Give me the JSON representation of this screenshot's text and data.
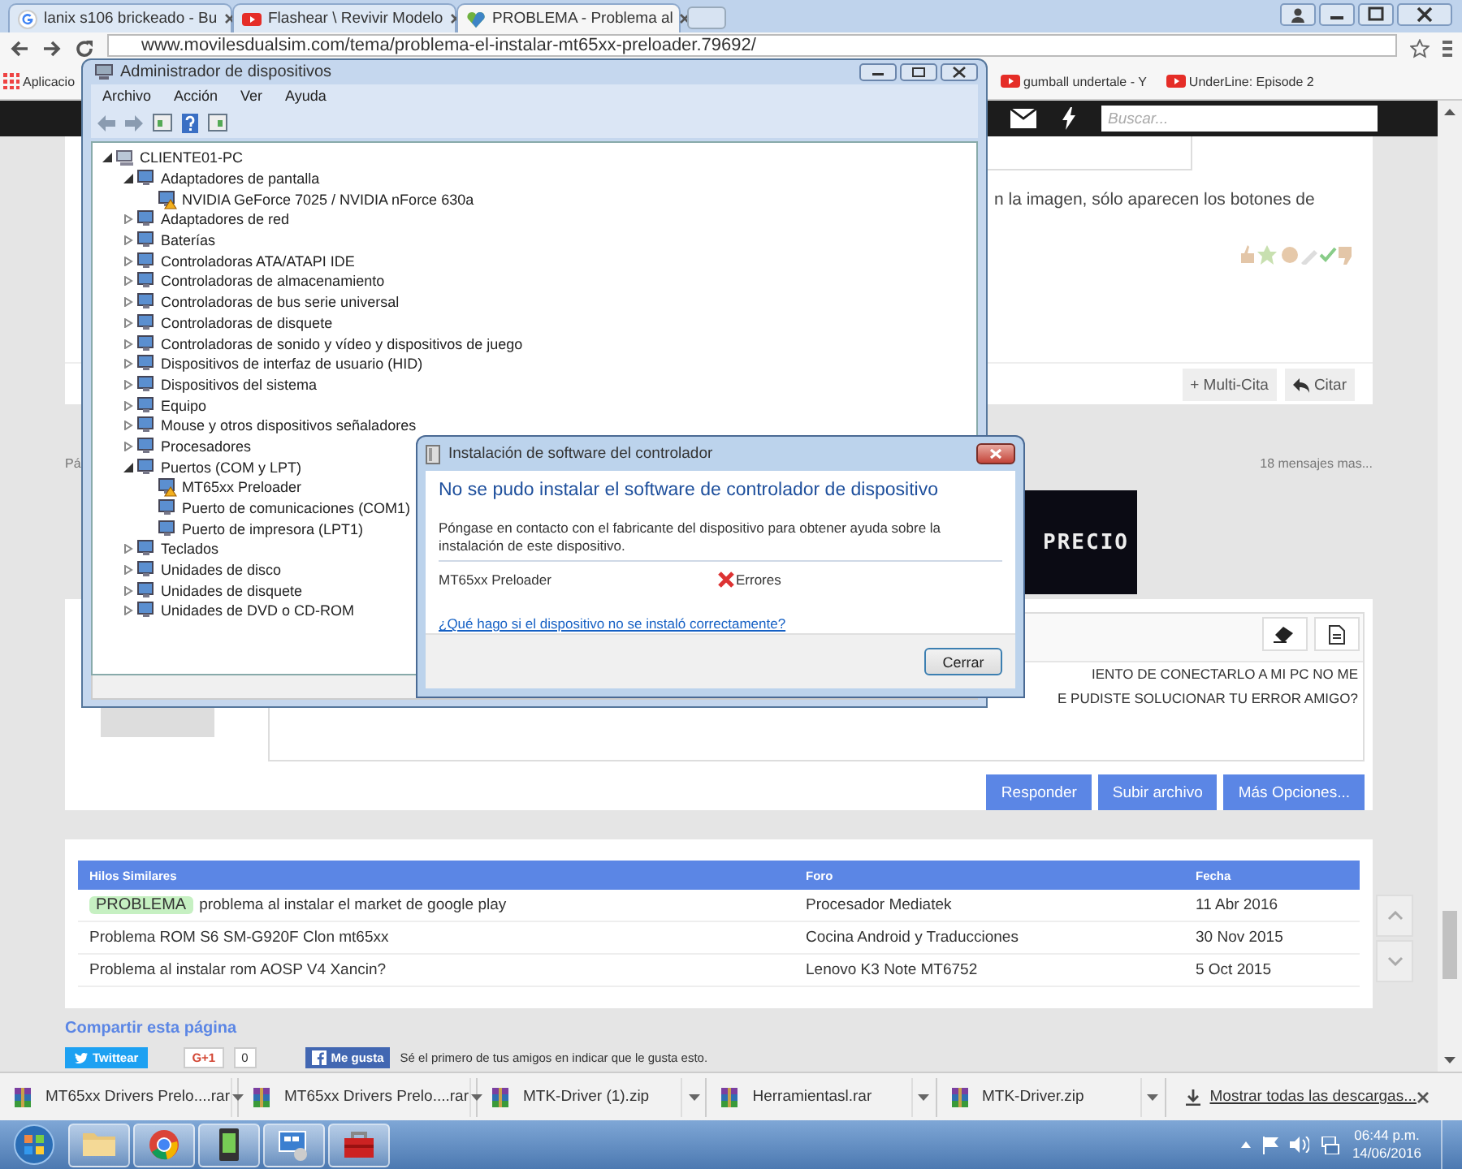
{
  "browser": {
    "tabs": [
      {
        "title": "lanix s106 brickeado - Bu",
        "selected": false
      },
      {
        "title": "Flashear \\ Revivir Modelo",
        "selected": false
      },
      {
        "title": "PROBLEMA - Problema al",
        "selected": true
      }
    ],
    "address": "www.movilesdualsim.com/tema/problema-el-instalar-mt65xx-preloader.79692/",
    "bookmarks": [
      {
        "label": "Aplicacio",
        "kind": "apps"
      },
      {
        "label": "gumball undertale - Y",
        "kind": "video"
      },
      {
        "label": "UnderLine: Episode 2",
        "kind": "video"
      }
    ]
  },
  "forum": {
    "search": {
      "placeholder": "Buscar..."
    },
    "post_text": "n la imagen, sólo aparecen los botones de",
    "post_buttons": [
      "+ Multi-Cita",
      "Citar"
    ],
    "page_label": "Pá",
    "more_messages": "18 mensajes mas...",
    "banner_text": "PRECIO",
    "editor_lines": [
      "IENTO DE CONECTARLO A MI PC NO ME",
      "E PUDISTE SOLUCIONAR TU ERROR AMIGO?"
    ],
    "editor_buttons": [
      "Responder",
      "Subir archivo",
      "Más Opciones..."
    ],
    "similar_threads": {
      "columns": [
        "Hilos Similares",
        "Foro",
        "Fecha"
      ],
      "rows": [
        {
          "tag": "PROBLEMA",
          "title": "problema al instalar el market de google play",
          "forum": "Procesador Mediatek",
          "date": "11 Abr 2016"
        },
        {
          "title": "Problema ROM S6 SM-G920F Clon mt65xx",
          "forum": "Cocina Android y Traducciones",
          "date": "30 Nov 2015"
        },
        {
          "title": "Problema al instalar rom AOSP V4 Xancin?",
          "forum": "Lenovo K3 Note MT6752",
          "date": "5 Oct 2015"
        }
      ]
    },
    "share": {
      "title": "Compartir esta página",
      "twitter": "Twittear",
      "gplus": "G+1",
      "gplus_count": "0",
      "like": "Me gusta",
      "like_text": "Sé el primero de tus amigos en indicar que le gusta esto."
    }
  },
  "device_manager": {
    "title": "Administrador de dispositivos",
    "menu": [
      "Archivo",
      "Acción",
      "Ver",
      "Ayuda"
    ],
    "tree": {
      "label": "CLIENTE01-PC",
      "expanded": true,
      "children": [
        {
          "label": "Adaptadores de pantalla",
          "expanded": true,
          "children": [
            {
              "label": "NVIDIA GeForce 7025 / NVIDIA nForce 630a",
              "problem": true
            }
          ]
        },
        {
          "label": "Adaptadores de red",
          "expanded": false
        },
        {
          "label": "Baterías",
          "expanded": false
        },
        {
          "label": "Controladoras ATA/ATAPI IDE",
          "expanded": false
        },
        {
          "label": "Controladoras de almacenamiento",
          "expanded": false
        },
        {
          "label": "Controladoras de bus serie universal",
          "expanded": false
        },
        {
          "label": "Controladoras de disquete",
          "expanded": false
        },
        {
          "label": "Controladoras de sonido y vídeo y dispositivos de juego",
          "expanded": false
        },
        {
          "label": "Dispositivos de interfaz de usuario (HID)",
          "expanded": false
        },
        {
          "label": "Dispositivos del sistema",
          "expanded": false
        },
        {
          "label": "Equipo",
          "expanded": false
        },
        {
          "label": "Mouse y otros dispositivos señaladores",
          "expanded": false
        },
        {
          "label": "Procesadores",
          "expanded": false
        },
        {
          "label": "Puertos (COM y LPT)",
          "expanded": true,
          "children": [
            {
              "label": "MT65xx Preloader",
              "problem": true
            },
            {
              "label": "Puerto de comunicaciones (COM1)",
              "problem": false
            },
            {
              "label": "Puerto de impresora (LPT1)",
              "problem": false
            }
          ]
        },
        {
          "label": "Teclados",
          "expanded": false
        },
        {
          "label": "Unidades de disco",
          "expanded": false
        },
        {
          "label": "Unidades de disquete",
          "expanded": false
        },
        {
          "label": "Unidades de DVD o CD-ROM",
          "expanded": false
        }
      ]
    }
  },
  "dialog": {
    "title": "Instalación de software del controlador",
    "heading": "No se pudo instalar el software de controlador de dispositivo",
    "message": "Póngase en contacto con el fabricante del dispositivo para obtener ayuda sobre la instalación de este dispositivo.",
    "device": "MT65xx Preloader",
    "status": "Errores",
    "link": "¿Qué hago si el dispositivo no se instaló correctamente?",
    "button": "Cerrar"
  },
  "downloads": {
    "items": [
      "MT65xx Drivers Prelo....rar",
      "MT65xx Drivers Prelo....rar",
      "MTK-Driver (1).zip",
      "Herramientasl.rar",
      "MTK-Driver.zip"
    ],
    "show_all": "Mostrar todas las descargas..."
  },
  "taskbar": {
    "time": "06:44 p.m.",
    "date": "14/06/2016"
  }
}
